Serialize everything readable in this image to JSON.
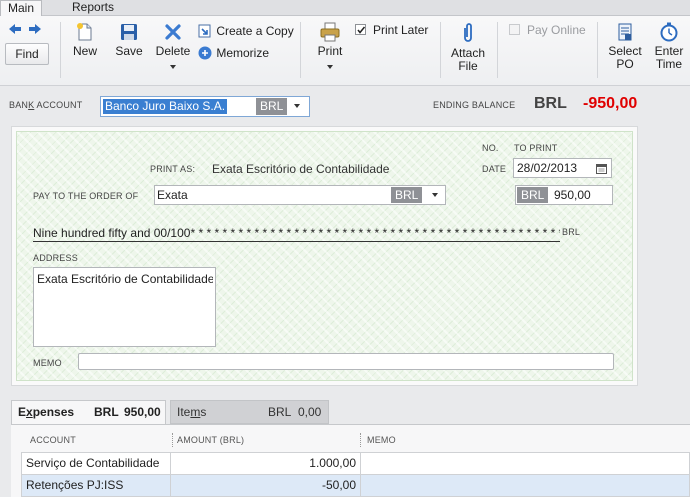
{
  "tabs": [
    {
      "label": "Main",
      "active": true
    },
    {
      "label": "Reports",
      "active": false
    }
  ],
  "toolbar": {
    "find": "Find",
    "new": "New",
    "save": "Save",
    "delete": "Delete",
    "create_copy": "Create a Copy",
    "memorize": "Memorize",
    "print": "Print",
    "print_later": "Print Later",
    "print_later_checked": true,
    "attach_file_1": "Attach",
    "attach_file_2": "File",
    "pay_online": "Pay Online",
    "pay_online_checked": false,
    "select_po_1": "Select",
    "select_po_2": "PO",
    "enter_time_1": "Enter",
    "enter_time_2": "Time"
  },
  "bank": {
    "label_pre": "BAN",
    "label_ul": "K",
    "label_post": " ACCOUNT",
    "account": "Banco Juro Baixo S.A.",
    "currency": "BRL",
    "ending_balance_label": "ENDING BALANCE",
    "ending_balance_currency": "BRL",
    "ending_balance_value": "-950,00"
  },
  "check": {
    "no_label": "NO.",
    "no_value": "TO PRINT",
    "date_label": "DATE",
    "date_value": "28/02/2013",
    "print_as_label": "PRINT AS:",
    "print_as_value": "Exata Escritório de Contabilidade",
    "payee_label": "PAY TO THE ORDER OF",
    "payee_value": "Exata",
    "payee_currency": "BRL",
    "amount_currency": "BRL",
    "amount_value": "950,00",
    "amount_words": "Nine hundred fifty and 00/100* * * * * * * * * * * * * * * * * * * * * * * * * * * * * * * * * * * * * * * * * * * * * * * * *",
    "amount_words_currency": "BRL",
    "address_label": "ADDRESS",
    "address_value": "Exata Escritório de Contabilidade",
    "memo_label": "MEMO",
    "memo_value": ""
  },
  "bottom_tabs": {
    "expenses_pre": "E",
    "expenses_ul": "x",
    "expenses_post": "penses",
    "expenses_currency": "BRL",
    "expenses_amount": "950,00",
    "items_pre": "Ite",
    "items_ul": "m",
    "items_post": "s",
    "items_currency": "BRL",
    "items_amount": "0,00"
  },
  "grid": {
    "columns": [
      "ACCOUNT",
      "AMOUNT (BRL)",
      "MEMO"
    ],
    "rows": [
      {
        "account": "Serviço de Contabilidade",
        "amount": "1.000,00",
        "memo": ""
      },
      {
        "account": "Retenções PJ:ISS",
        "amount": "-50,00",
        "memo": ""
      }
    ]
  },
  "colors": {
    "negative": "#e00000",
    "selection": "#3a7fd1",
    "check_background": "#eef6eb"
  }
}
